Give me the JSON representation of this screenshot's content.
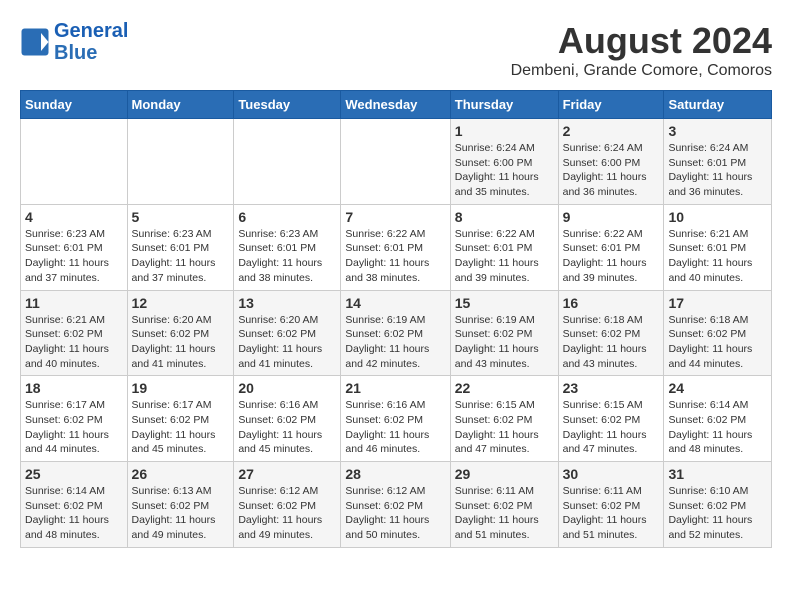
{
  "header": {
    "logo_line1": "General",
    "logo_line2": "Blue",
    "month_year": "August 2024",
    "location": "Dembeni, Grande Comore, Comoros"
  },
  "days_of_week": [
    "Sunday",
    "Monday",
    "Tuesday",
    "Wednesday",
    "Thursday",
    "Friday",
    "Saturday"
  ],
  "weeks": [
    [
      {
        "day": "",
        "detail": ""
      },
      {
        "day": "",
        "detail": ""
      },
      {
        "day": "",
        "detail": ""
      },
      {
        "day": "",
        "detail": ""
      },
      {
        "day": "1",
        "detail": "Sunrise: 6:24 AM\nSunset: 6:00 PM\nDaylight: 11 hours\nand 35 minutes."
      },
      {
        "day": "2",
        "detail": "Sunrise: 6:24 AM\nSunset: 6:00 PM\nDaylight: 11 hours\nand 36 minutes."
      },
      {
        "day": "3",
        "detail": "Sunrise: 6:24 AM\nSunset: 6:01 PM\nDaylight: 11 hours\nand 36 minutes."
      }
    ],
    [
      {
        "day": "4",
        "detail": "Sunrise: 6:23 AM\nSunset: 6:01 PM\nDaylight: 11 hours\nand 37 minutes."
      },
      {
        "day": "5",
        "detail": "Sunrise: 6:23 AM\nSunset: 6:01 PM\nDaylight: 11 hours\nand 37 minutes."
      },
      {
        "day": "6",
        "detail": "Sunrise: 6:23 AM\nSunset: 6:01 PM\nDaylight: 11 hours\nand 38 minutes."
      },
      {
        "day": "7",
        "detail": "Sunrise: 6:22 AM\nSunset: 6:01 PM\nDaylight: 11 hours\nand 38 minutes."
      },
      {
        "day": "8",
        "detail": "Sunrise: 6:22 AM\nSunset: 6:01 PM\nDaylight: 11 hours\nand 39 minutes."
      },
      {
        "day": "9",
        "detail": "Sunrise: 6:22 AM\nSunset: 6:01 PM\nDaylight: 11 hours\nand 39 minutes."
      },
      {
        "day": "10",
        "detail": "Sunrise: 6:21 AM\nSunset: 6:01 PM\nDaylight: 11 hours\nand 40 minutes."
      }
    ],
    [
      {
        "day": "11",
        "detail": "Sunrise: 6:21 AM\nSunset: 6:02 PM\nDaylight: 11 hours\nand 40 minutes."
      },
      {
        "day": "12",
        "detail": "Sunrise: 6:20 AM\nSunset: 6:02 PM\nDaylight: 11 hours\nand 41 minutes."
      },
      {
        "day": "13",
        "detail": "Sunrise: 6:20 AM\nSunset: 6:02 PM\nDaylight: 11 hours\nand 41 minutes."
      },
      {
        "day": "14",
        "detail": "Sunrise: 6:19 AM\nSunset: 6:02 PM\nDaylight: 11 hours\nand 42 minutes."
      },
      {
        "day": "15",
        "detail": "Sunrise: 6:19 AM\nSunset: 6:02 PM\nDaylight: 11 hours\nand 43 minutes."
      },
      {
        "day": "16",
        "detail": "Sunrise: 6:18 AM\nSunset: 6:02 PM\nDaylight: 11 hours\nand 43 minutes."
      },
      {
        "day": "17",
        "detail": "Sunrise: 6:18 AM\nSunset: 6:02 PM\nDaylight: 11 hours\nand 44 minutes."
      }
    ],
    [
      {
        "day": "18",
        "detail": "Sunrise: 6:17 AM\nSunset: 6:02 PM\nDaylight: 11 hours\nand 44 minutes."
      },
      {
        "day": "19",
        "detail": "Sunrise: 6:17 AM\nSunset: 6:02 PM\nDaylight: 11 hours\nand 45 minutes."
      },
      {
        "day": "20",
        "detail": "Sunrise: 6:16 AM\nSunset: 6:02 PM\nDaylight: 11 hours\nand 45 minutes."
      },
      {
        "day": "21",
        "detail": "Sunrise: 6:16 AM\nSunset: 6:02 PM\nDaylight: 11 hours\nand 46 minutes."
      },
      {
        "day": "22",
        "detail": "Sunrise: 6:15 AM\nSunset: 6:02 PM\nDaylight: 11 hours\nand 47 minutes."
      },
      {
        "day": "23",
        "detail": "Sunrise: 6:15 AM\nSunset: 6:02 PM\nDaylight: 11 hours\nand 47 minutes."
      },
      {
        "day": "24",
        "detail": "Sunrise: 6:14 AM\nSunset: 6:02 PM\nDaylight: 11 hours\nand 48 minutes."
      }
    ],
    [
      {
        "day": "25",
        "detail": "Sunrise: 6:14 AM\nSunset: 6:02 PM\nDaylight: 11 hours\nand 48 minutes."
      },
      {
        "day": "26",
        "detail": "Sunrise: 6:13 AM\nSunset: 6:02 PM\nDaylight: 11 hours\nand 49 minutes."
      },
      {
        "day": "27",
        "detail": "Sunrise: 6:12 AM\nSunset: 6:02 PM\nDaylight: 11 hours\nand 49 minutes."
      },
      {
        "day": "28",
        "detail": "Sunrise: 6:12 AM\nSunset: 6:02 PM\nDaylight: 11 hours\nand 50 minutes."
      },
      {
        "day": "29",
        "detail": "Sunrise: 6:11 AM\nSunset: 6:02 PM\nDaylight: 11 hours\nand 51 minutes."
      },
      {
        "day": "30",
        "detail": "Sunrise: 6:11 AM\nSunset: 6:02 PM\nDaylight: 11 hours\nand 51 minutes."
      },
      {
        "day": "31",
        "detail": "Sunrise: 6:10 AM\nSunset: 6:02 PM\nDaylight: 11 hours\nand 52 minutes."
      }
    ]
  ]
}
